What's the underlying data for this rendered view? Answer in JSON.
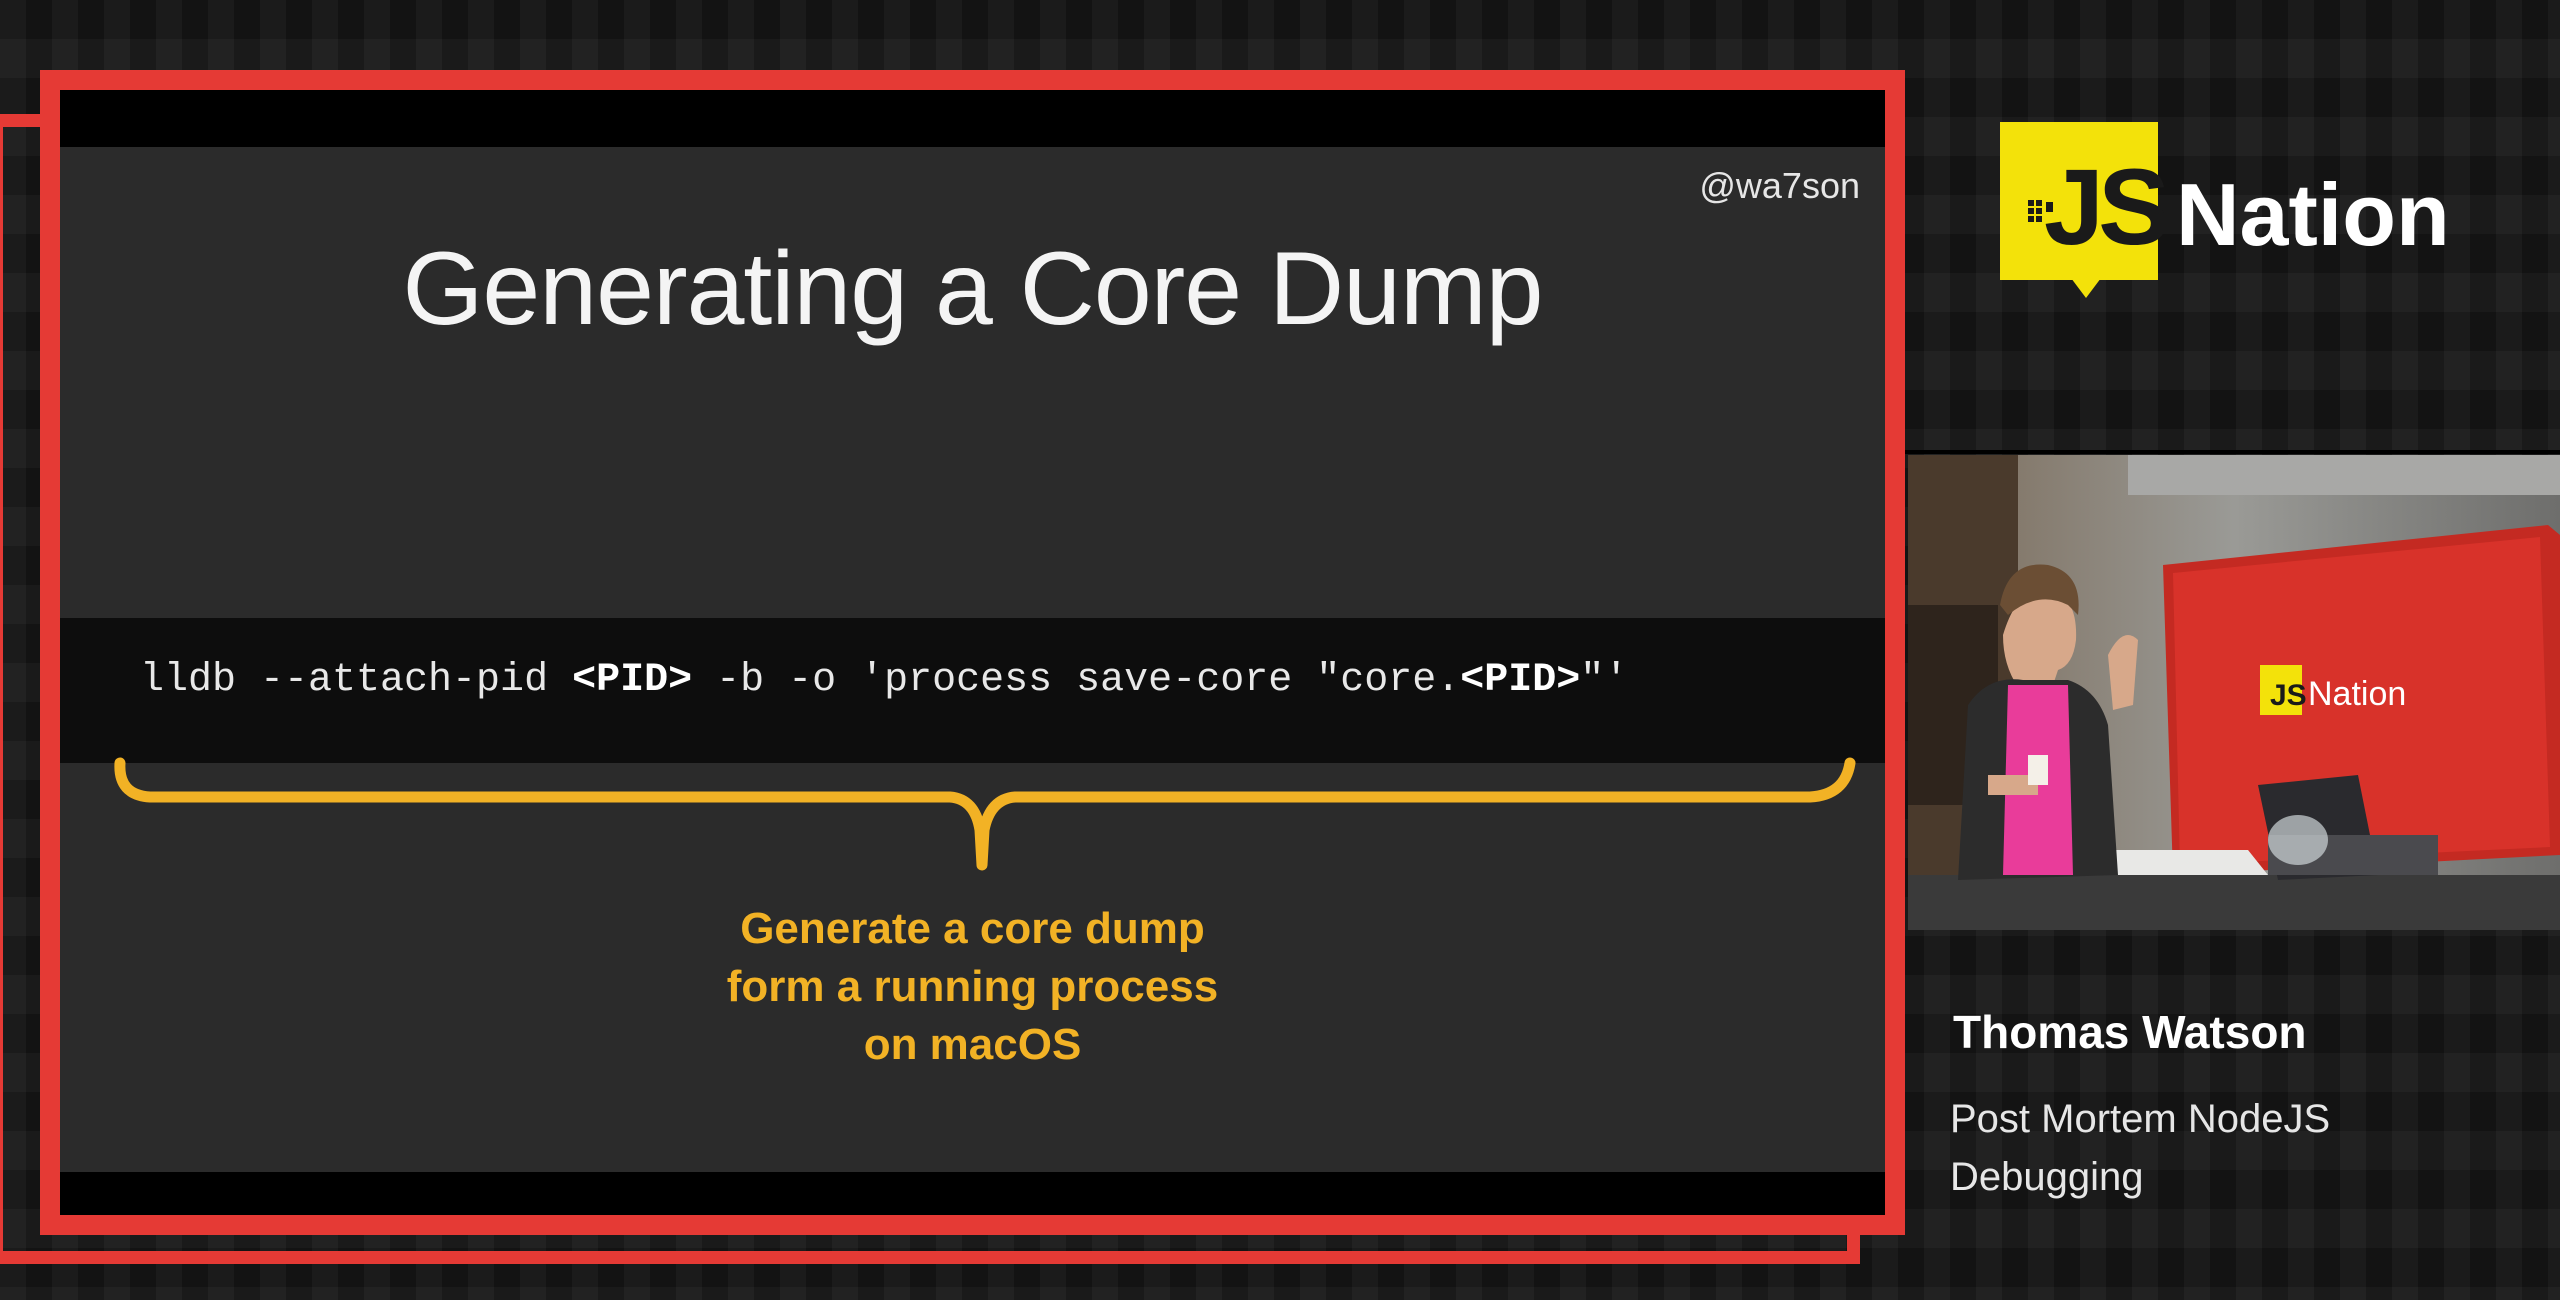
{
  "slide": {
    "handle": "@wa7son",
    "title": "Generating a Core Dump",
    "code": {
      "part1": "lldb --attach-pid ",
      "pid1": "<PID>",
      "part2": " -b -o 'process save-core \"core.",
      "pid2": "<PID>",
      "part3": "\"'"
    },
    "caption_lines": [
      "Generate a core dump",
      "form a running process",
      "on macOS"
    ]
  },
  "branding": {
    "logo_mark": "JS",
    "logo_name": "Nation",
    "accent_color": "#e53a35",
    "logo_color": "#f3e20a",
    "caption_color": "#f2b225"
  },
  "camera": {
    "backdrop_logo_mark": "JS",
    "backdrop_logo_name": "Nation"
  },
  "speaker": {
    "name": "Thomas Watson",
    "talk_title": "Post Mortem NodeJS Debugging"
  }
}
